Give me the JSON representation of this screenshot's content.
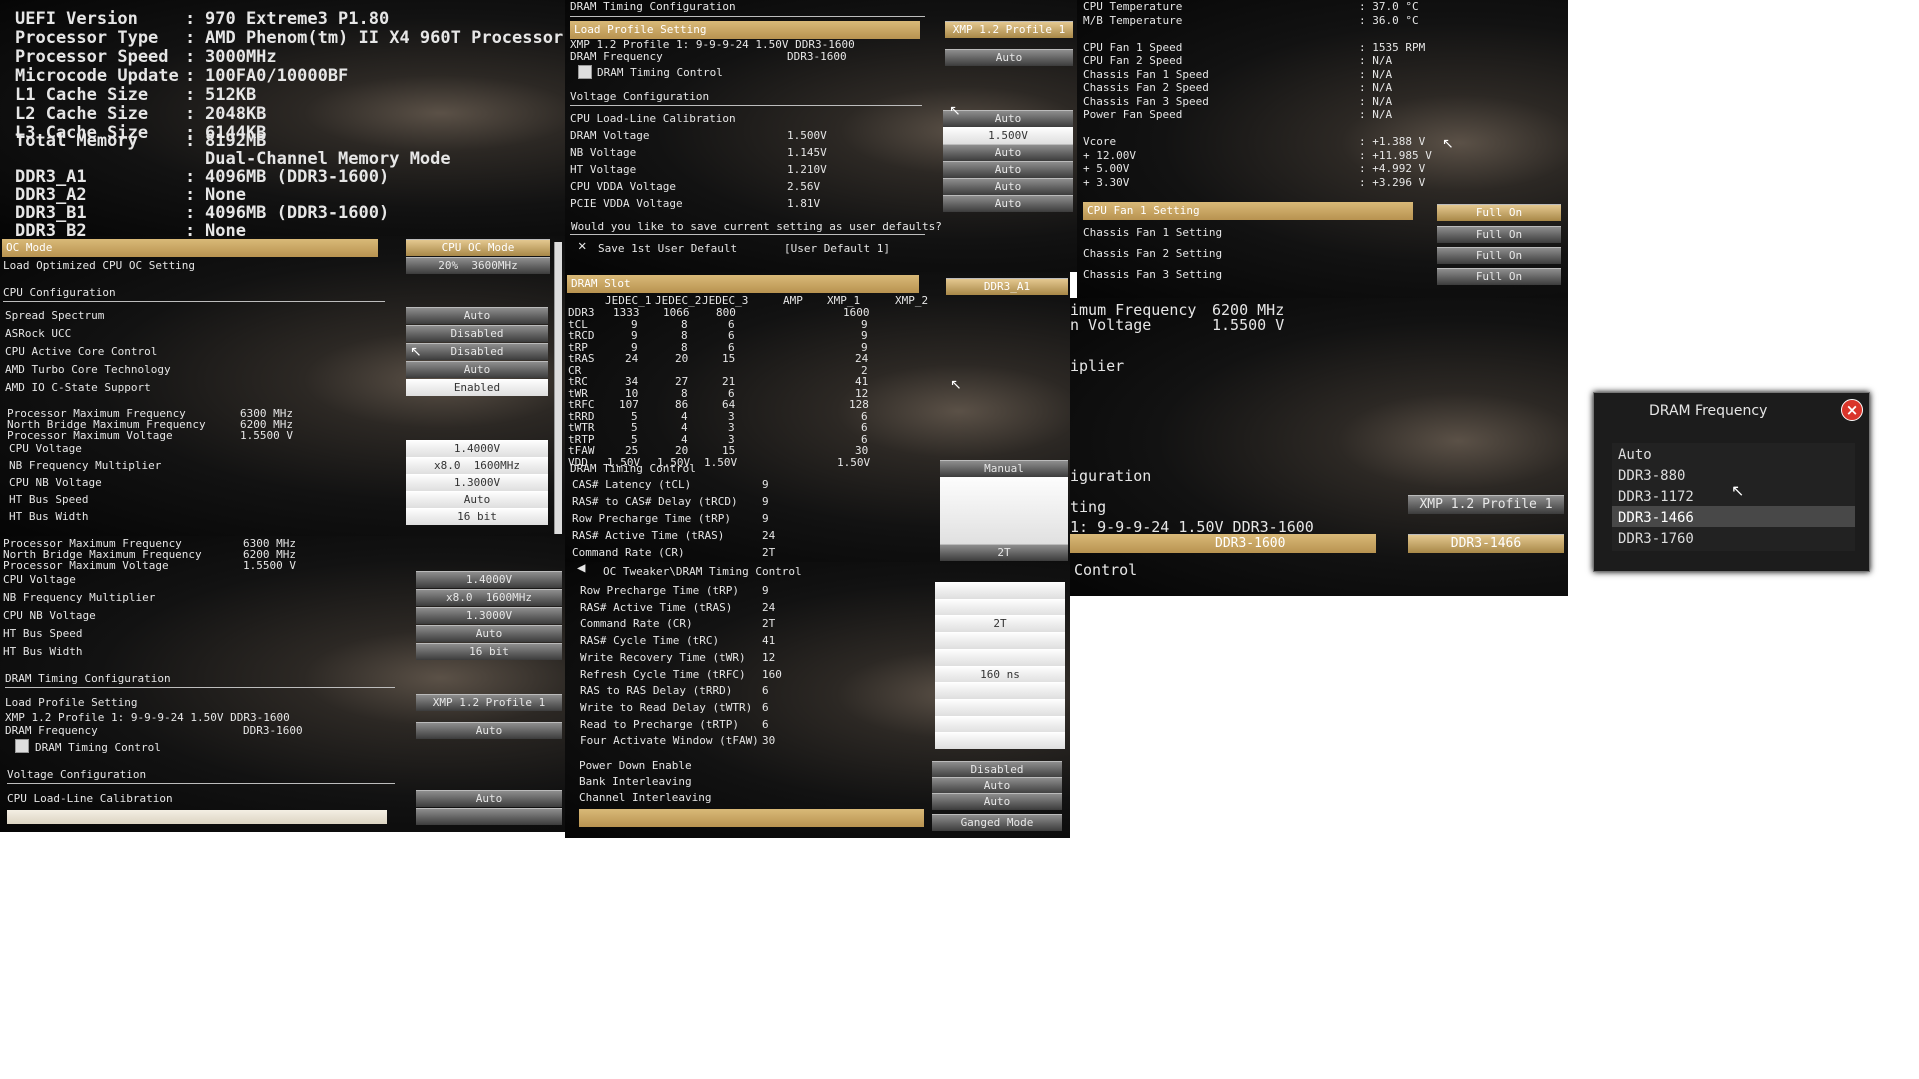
{
  "sysinfo": {
    "rows": [
      [
        "UEFI Version",
        ":",
        "970 Extreme3 P1.80"
      ],
      [
        "Processor Type",
        ":",
        "AMD Phenom(tm) II X4 960T Processor"
      ],
      [
        "Processor Speed",
        ":",
        "3000MHz"
      ],
      [
        "Microcode Update",
        ":",
        "100FA0/10000BF"
      ],
      [
        "L1 Cache Size",
        ":",
        "512KB"
      ],
      [
        "L2 Cache Size",
        ":",
        "2048KB"
      ],
      [
        "L3 Cache Size",
        ":",
        "6144KB"
      ]
    ],
    "mem_rows": [
      [
        "Total Memory",
        ":",
        "8192MB"
      ],
      [
        "",
        "",
        "Dual-Channel Memory Mode"
      ],
      [
        "DDR3_A1",
        ":",
        "4096MB (DDR3-1600)"
      ],
      [
        "DDR3_A2",
        ":",
        "None"
      ],
      [
        "DDR3_B1",
        ":",
        "4096MB (DDR3-1600)"
      ],
      [
        "DDR3_B2",
        ":",
        "None"
      ]
    ]
  },
  "oc": {
    "oc_mode_label": "OC Mode",
    "oc_mode_value": "CPU OC Mode",
    "load_label": "Load Optimized CPU OC Setting",
    "load_value": "20%  3600MHz",
    "cpu_config": "CPU Configuration",
    "items": [
      [
        "Spread Spectrum",
        "Auto"
      ],
      [
        "ASRock UCC",
        "Disabled"
      ],
      [
        "CPU Active Core Control",
        "Disabled"
      ],
      [
        "AMD Turbo Core Technology",
        "Auto"
      ],
      [
        "AMD IO C-State Support",
        "Enabled"
      ]
    ],
    "info": [
      [
        "Processor Maximum Frequency",
        "6300 MHz"
      ],
      [
        "North Bridge Maximum Frequency",
        "6200 MHz"
      ],
      [
        "Processor Maximum Voltage",
        "1.5500 V"
      ]
    ],
    "items2": [
      [
        "CPU Voltage",
        "1.4000V"
      ],
      [
        "NB Frequency Multiplier",
        "x8.0  1600MHz"
      ],
      [
        "CPU NB Voltage",
        "1.3000V"
      ],
      [
        "HT Bus Speed",
        "Auto"
      ],
      [
        "HT Bus Width",
        "16 bit"
      ]
    ]
  },
  "oc2": {
    "info": [
      [
        "Processor Maximum Frequency",
        "6300 MHz"
      ],
      [
        "North Bridge Maximum Frequency",
        "6200 MHz"
      ],
      [
        "Processor Maximum Voltage",
        "1.5500 V"
      ]
    ],
    "items": [
      [
        "CPU Voltage",
        "1.4000V"
      ],
      [
        "NB Frequency Multiplier",
        "x8.0  1600MHz"
      ],
      [
        "CPU NB Voltage",
        "1.3000V"
      ],
      [
        "HT Bus Speed",
        "Auto"
      ],
      [
        "HT Bus Width",
        "16 bit"
      ]
    ],
    "dram_cfg": "DRAM Timing Configuration",
    "load_profile": "Load Profile Setting",
    "load_profile_value": "XMP 1.2 Profile 1",
    "xmp_line": "XMP 1.2 Profile 1: 9-9-9-24 1.50V DDR3-1600",
    "dram_freq": "DRAM Frequency",
    "dram_freq_val": "DDR3-1600",
    "dram_freq_btn": "Auto",
    "dram_timing_ctrl": "DRAM Timing Control",
    "voltage_cfg": "Voltage Configuration",
    "llc": "CPU Load-Line Calibration",
    "llc_value": "Auto"
  },
  "dramcfg": {
    "title": "DRAM Timing Configuration",
    "load_profile": "Load Profile Setting",
    "load_profile_value": "XMP 1.2 Profile 1",
    "xmp_line": "XMP 1.2 Profile 1: 9-9-9-24 1.50V DDR3-1600",
    "dram_freq": "DRAM Frequency",
    "dram_freq_val": "DDR3-1600",
    "dram_freq_btn": "Auto",
    "dram_timing_ctrl": "DRAM Timing Control",
    "voltage_cfg": "Voltage Configuration",
    "volts": [
      [
        "CPU Load-Line Calibration",
        "",
        "Auto"
      ],
      [
        "DRAM Voltage",
        "1.500V",
        "1.500V"
      ],
      [
        "NB Voltage",
        "1.145V",
        "Auto"
      ],
      [
        "HT Voltage",
        "1.210V",
        "Auto"
      ],
      [
        "CPU VDDA Voltage",
        "2.56V",
        "Auto"
      ],
      [
        "PCIE VDDA Voltage",
        "1.81V",
        "Auto"
      ]
    ],
    "save_q": "Would you like to save current setting as user defaults?",
    "save_item": "Save 1st User Default",
    "save_val": "[User Default 1]"
  },
  "hw": {
    "rows": [
      [
        "CPU Temperature",
        ": 37.0 °C"
      ],
      [
        "M/B Temperature",
        ": 36.0 °C"
      ],
      [
        "",
        ""
      ],
      [
        "CPU Fan 1 Speed",
        ": 1535 RPM"
      ],
      [
        "CPU Fan 2 Speed",
        ": N/A"
      ],
      [
        "Chassis Fan 1 Speed",
        ": N/A"
      ],
      [
        "Chassis Fan 2 Speed",
        ": N/A"
      ],
      [
        "Chassis Fan 3 Speed",
        ": N/A"
      ],
      [
        "Power Fan Speed",
        ": N/A"
      ],
      [
        "",
        ""
      ],
      [
        "Vcore",
        ": +1.388 V"
      ],
      [
        "+ 12.00V",
        ": +11.985 V"
      ],
      [
        "+ 5.00V",
        ": +4.992 V"
      ],
      [
        "+ 3.30V",
        ": +3.296 V"
      ]
    ],
    "fan_hl": "CPU Fan 1 Setting",
    "fan_hl_val": "Full On",
    "fans": [
      [
        "Chassis Fan 1 Setting",
        "Full On"
      ],
      [
        "Chassis Fan 2 Setting",
        "Full On"
      ],
      [
        "Chassis Fan 3 Setting",
        "Full On"
      ]
    ]
  },
  "spd": {
    "slot_label": "DRAM Slot",
    "slot_value": "DDR3_A1",
    "headers": [
      "",
      "JEDEC_1",
      "JEDEC_2",
      "JEDEC_3",
      "AMP",
      "XMP_1",
      "XMP_2"
    ],
    "rows": [
      [
        "DDR3",
        "1333",
        "1066",
        "800",
        "",
        "1600",
        ""
      ],
      [
        "tCL",
        "9",
        "8",
        "6",
        "",
        "9",
        ""
      ],
      [
        "tRCD",
        "9",
        "8",
        "6",
        "",
        "9",
        ""
      ],
      [
        "tRP",
        "9",
        "8",
        "6",
        "",
        "9",
        ""
      ],
      [
        "tRAS",
        "24",
        "20",
        "15",
        "",
        "24",
        ""
      ],
      [
        "CR",
        "",
        "",
        "",
        "",
        "2",
        ""
      ],
      [
        "tRC",
        "34",
        "27",
        "21",
        "",
        "41",
        ""
      ],
      [
        "tWR",
        "10",
        "8",
        "6",
        "",
        "12",
        ""
      ],
      [
        "tRFC",
        "107",
        "86",
        "64",
        "",
        "128",
        ""
      ],
      [
        "tRRD",
        "5",
        "4",
        "3",
        "",
        "6",
        ""
      ],
      [
        "tWTR",
        "5",
        "4",
        "3",
        "",
        "6",
        ""
      ],
      [
        "tRTP",
        "5",
        "4",
        "3",
        "",
        "6",
        ""
      ],
      [
        "tFAW",
        "25",
        "20",
        "15",
        "",
        "30",
        ""
      ],
      [
        "VDD",
        "1.50V",
        "1.50V",
        "1.50V",
        "",
        "1.50V",
        ""
      ]
    ],
    "dtc": "DRAM Timing Control",
    "dtc_val": "Manual",
    "timings": [
      [
        "CAS# Latency (tCL)",
        "9"
      ],
      [
        "RAS# to CAS# Delay (tRCD)",
        "9"
      ],
      [
        "Row Precharge Time (tRP)",
        "9"
      ],
      [
        "RAS# Active Time (tRAS)",
        "24"
      ],
      [
        "Command Rate (CR)",
        "2T"
      ]
    ],
    "cr_btn": "2T"
  },
  "tweak": {
    "title": "OC Tweaker\\DRAM Timing Control",
    "rows": [
      [
        "Row Precharge Time (tRP)",
        "9",
        ""
      ],
      [
        "RAS# Active Time (tRAS)",
        "24",
        ""
      ],
      [
        "Command Rate (CR)",
        "2T",
        "2T"
      ],
      [
        "RAS# Cycle Time (tRC)",
        "41",
        ""
      ],
      [
        "Write Recovery Time (tWR)",
        "12",
        ""
      ],
      [
        "Refresh Cycle Time (tRFC)",
        "160",
        "160 ns"
      ],
      [
        "RAS to RAS Delay (tRRD)",
        "6",
        ""
      ],
      [
        "Write to Read Delay (tWTR)",
        "6",
        ""
      ],
      [
        "Read to Precharge (tRTP)",
        "6",
        ""
      ],
      [
        "Four Activate Window (tFAW)",
        "30",
        ""
      ]
    ],
    "rows2": [
      [
        "Power Down Enable",
        "Disabled"
      ],
      [
        "Bank Interleaving",
        "Auto"
      ],
      [
        "Channel Interleaving",
        "Auto"
      ]
    ],
    "last_btn": "Ganged Mode"
  },
  "popup_bg": {
    "max_freq": "imum Frequency",
    "max_freq_val": "6200 MHz",
    "voltage": "n Voltage",
    "voltage_val": "1.5500 V",
    "multiplier": "iplier",
    "config": "iguration",
    "setting": "ting",
    "setting_val": "XMP 1.2 Profile 1",
    "xmp_line": "1: 9-9-9-24 1.50V DDR3-1600",
    "freq_bar": "DDR3-1600",
    "freq_btn": "DDR3-1466",
    "control": "Control"
  },
  "popup": {
    "title": "DRAM Frequency",
    "close": "×",
    "options": [
      "Auto",
      "DDR3-880",
      "DDR3-1172",
      "DDR3-1466",
      "DDR3-1760"
    ],
    "selected": "DDR3-1466"
  },
  "colors": {
    "highlight": "#c9a564",
    "button": "#6a6a6a",
    "bg": "#0d0d0d",
    "popup_close": "#d9352b"
  }
}
